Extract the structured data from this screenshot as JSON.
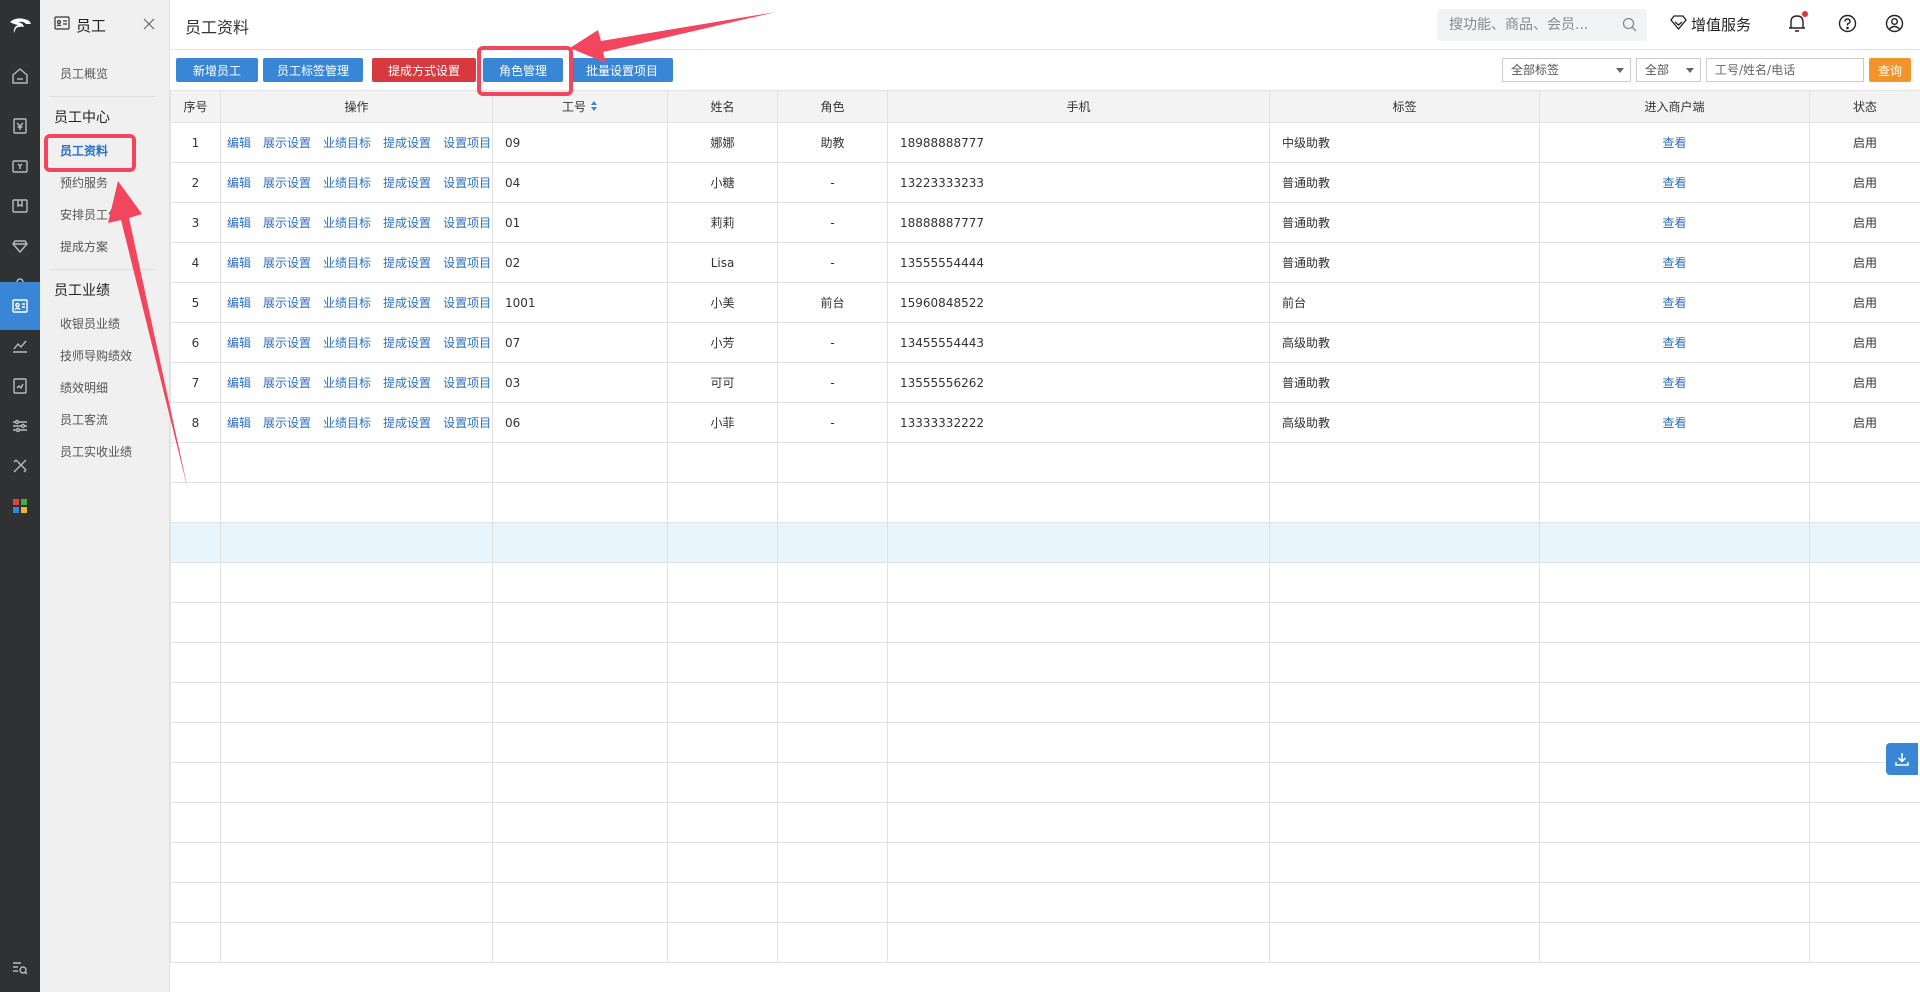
{
  "menu": {
    "title": "员工",
    "items_top": [
      "员工概览"
    ],
    "group1": "员工中心",
    "group1_items": [
      "员工资料",
      "预约服务",
      "安排员工位",
      "提成方案"
    ],
    "group2": "员工业绩",
    "group2_items": [
      "收银员业绩",
      "技师导购绩效",
      "绩效明细",
      "员工客流",
      "员工实收业绩"
    ]
  },
  "header": {
    "page_title": "员工资料",
    "search_placeholder": "搜功能、商品、会员...",
    "value_service": "增值服务"
  },
  "toolbar": {
    "add_staff": "新增员工",
    "tag_manage": "员工标签管理",
    "commission_setting": "提成方式设置",
    "role_manage": "角色管理",
    "batch_setting": "批量设置项目",
    "tag_filter": "全部标签",
    "status_filter": "全部",
    "keyword_placeholder": "工号/姓名/电话",
    "query": "查询"
  },
  "table": {
    "columns": [
      "序号",
      "操作",
      "工号",
      "姓名",
      "角色",
      "手机",
      "标签",
      "进入商户端",
      "状态"
    ],
    "ops": [
      "编辑",
      "展示设置",
      "业绩目标",
      "提成设置",
      "设置项目"
    ],
    "view_label": "查看",
    "rows": [
      {
        "no": "1",
        "id": "09",
        "name": "娜娜",
        "role": "助教",
        "phone": "18988888777",
        "tag": "中级助教",
        "status": "启用"
      },
      {
        "no": "2",
        "id": "04",
        "name": "小糖",
        "role": "-",
        "phone": "13223333233",
        "tag": "普通助教",
        "status": "启用"
      },
      {
        "no": "3",
        "id": "01",
        "name": "莉莉",
        "role": "-",
        "phone": "18888887777",
        "tag": "普通助教",
        "status": "启用"
      },
      {
        "no": "4",
        "id": "02",
        "name": "Lisa",
        "role": "-",
        "phone": "13555554444",
        "tag": "普通助教",
        "status": "启用"
      },
      {
        "no": "5",
        "id": "1001",
        "name": "小美",
        "role": "前台",
        "phone": "15960848522",
        "tag": "前台",
        "status": "启用"
      },
      {
        "no": "6",
        "id": "07",
        "name": "小芳",
        "role": "-",
        "phone": "13455554443",
        "tag": "高级助教",
        "status": "启用"
      },
      {
        "no": "7",
        "id": "03",
        "name": "可可",
        "role": "-",
        "phone": "13555556262",
        "tag": "普通助教",
        "status": "启用"
      },
      {
        "no": "8",
        "id": "06",
        "name": "小菲",
        "role": "-",
        "phone": "13333332222",
        "tag": "高级助教",
        "status": "启用"
      }
    ]
  },
  "colors": {
    "primary": "#3a86d6",
    "danger": "#d6393e",
    "query": "#f0942b",
    "rail": "#2f3133",
    "annotation": "#f1465e"
  }
}
